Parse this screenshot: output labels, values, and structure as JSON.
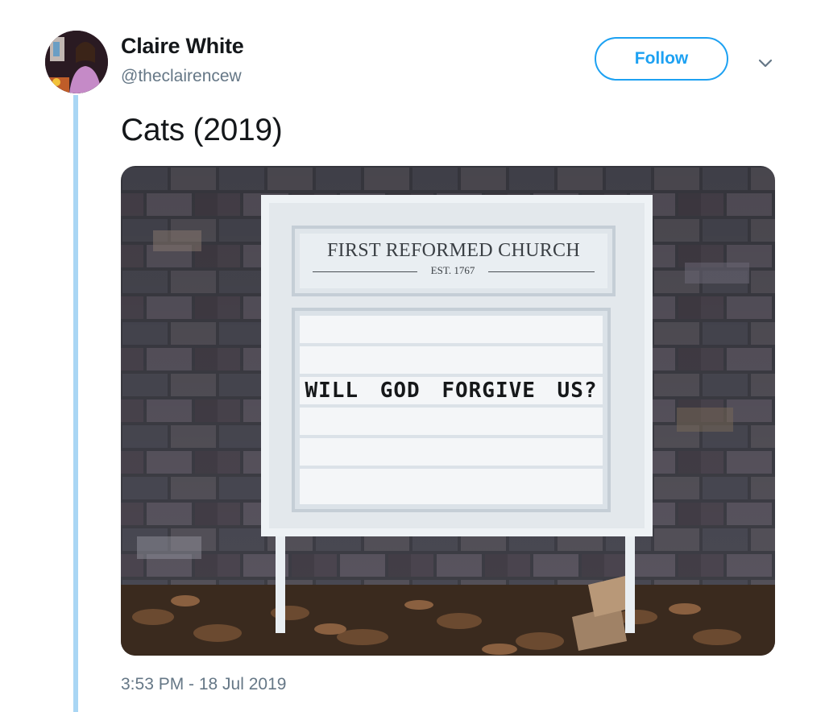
{
  "author": {
    "name": "Claire White",
    "handle": "@theclairencew"
  },
  "actions": {
    "follow_label": "Follow"
  },
  "tweet": {
    "text": "Cats (2019)",
    "timestamp": "3:53 PM - 18 Jul 2019"
  },
  "media": {
    "sign_header": "FIRST REFORMED CHURCH",
    "sign_est": "EST. 1767",
    "sign_message": "WILL GOD FORGIVE US?"
  },
  "colors": {
    "accent": "#1da1f2",
    "thread_line": "#a9d6f4",
    "secondary_text": "#657786"
  },
  "icons": {
    "menu": "chevron-down-icon"
  }
}
